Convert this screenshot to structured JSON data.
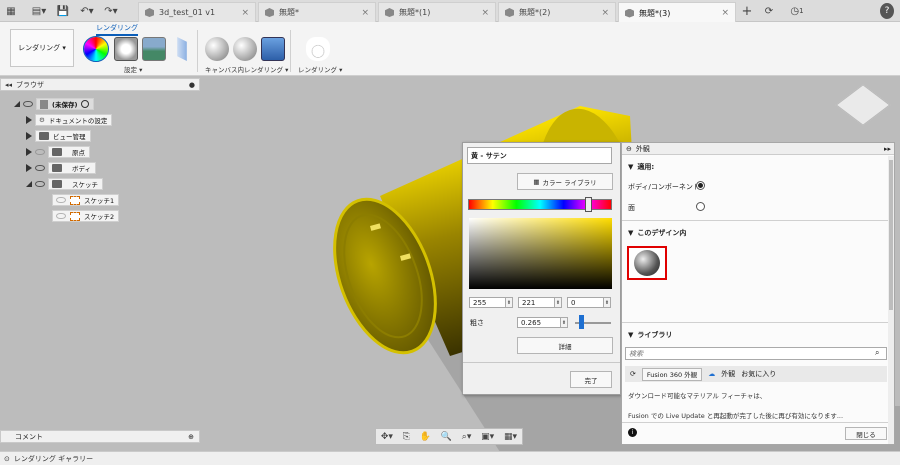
{
  "tabs": [
    {
      "label": "3d_test_01 v1",
      "active": false
    },
    {
      "label": "無題*",
      "active": false
    },
    {
      "label": "無題*(1)",
      "active": false
    },
    {
      "label": "無題*(2)",
      "active": false
    },
    {
      "label": "無題*(3)",
      "active": true
    }
  ],
  "top_right": {
    "clock_count": "1",
    "help": "?"
  },
  "ribbon": {
    "mode_label": "レンダリング ▾",
    "tab_label": "レンダリング",
    "group_setup": "設定 ▾",
    "group_canvas": "キャンバス内レンダリング ▾",
    "group_render": "レンダリング ▾"
  },
  "browser": {
    "title": "ブラウザ",
    "root": "(未保存)",
    "items": [
      "ドキュメントの設定",
      "ビュー管理",
      "原点",
      "ボディ",
      "スケッチ"
    ],
    "sketches": [
      "スケッチ1",
      "スケッチ2"
    ]
  },
  "comment_label": "コメント",
  "status_label": "レンダリング ギャラリー",
  "color_picker": {
    "name": "黄 - サテン",
    "color_library_btn": "カラー ライブラリ",
    "r": "255",
    "g": "221",
    "b": "0",
    "roughness_label": "粗さ",
    "roughness_value": "0.265",
    "details_btn": "詳細",
    "done_btn": "完了"
  },
  "appearance": {
    "title": "外観",
    "apply_section": "適用:",
    "opt_body": "ボディ/コンポーネント",
    "opt_face": "面",
    "in_design_section": "このデザイン内",
    "library_section": "ライブラリ",
    "search_placeholder": "検索",
    "tab_fusion": "Fusion 360 外観",
    "tab_appearance": "外観",
    "tab_favorites": "お気に入り",
    "note1": "ダウンロード可能なマテリアル フィーチャは、",
    "note2": "Fusion での Live Update と再起動が完了した後に再び有効になります...",
    "close_btn": "閉じる"
  },
  "colors": {
    "accent": "#0a5db8",
    "highlight": "#e00000",
    "model": "#e8d200"
  }
}
